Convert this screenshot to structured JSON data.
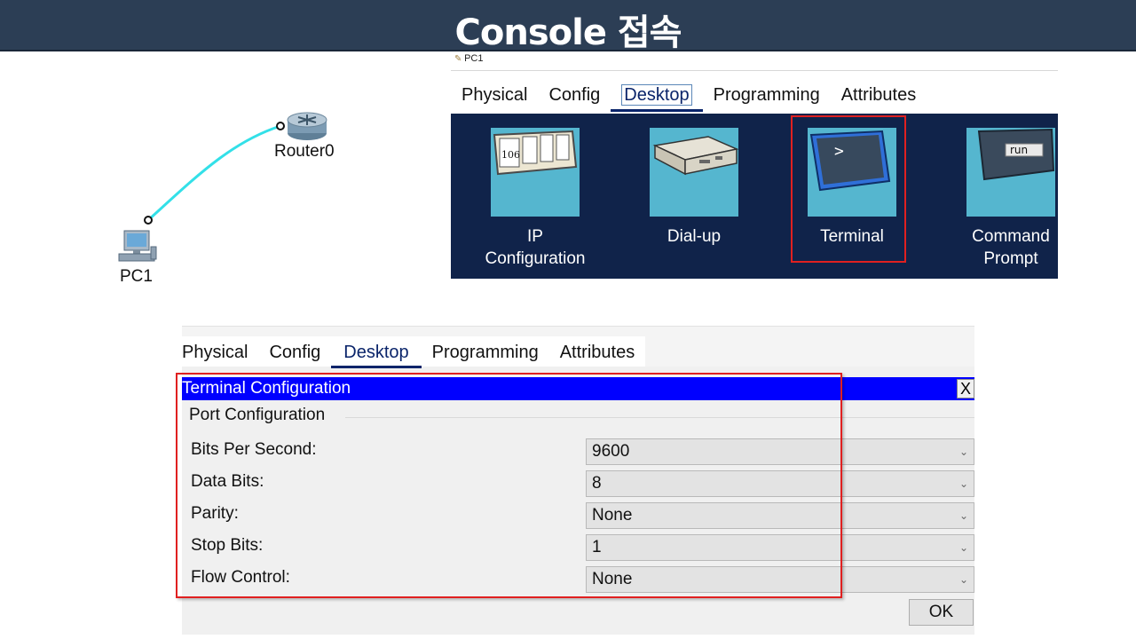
{
  "slide": {
    "title": "Console 접속",
    "colors": {
      "title_bg": "#2c3e55",
      "highlight": "#e02020",
      "desktop_bg": "#10234a",
      "tile": "#55b6cf",
      "term_header": "#0000ff"
    }
  },
  "topology": {
    "router_label": "Router0",
    "pc_label": "PC1",
    "link_color": "#33e0e8",
    "router_icon": "router-icon",
    "pc_icon": "pc-icon"
  },
  "device_window": {
    "title": "PC1",
    "tabs": [
      "Physical",
      "Config",
      "Desktop",
      "Programming",
      "Attributes"
    ],
    "active_tab": "Desktop",
    "apps": [
      {
        "label_line1": "IP",
        "label_line2": "Configuration",
        "icon": "ip-config-icon",
        "tile_text": "106"
      },
      {
        "label_line1": "Dial-up",
        "label_line2": "",
        "icon": "dial-up-modem-icon"
      },
      {
        "label_line1": "Terminal",
        "label_line2": "",
        "icon": "terminal-icon",
        "tile_text": ">"
      },
      {
        "label_line1": "Command",
        "label_line2": "Prompt",
        "icon": "command-prompt-icon",
        "tile_text": "run"
      }
    ]
  },
  "terminal_window": {
    "tabs": [
      "Physical",
      "Config",
      "Desktop",
      "Programming",
      "Attributes"
    ],
    "active_tab": "Desktop",
    "header": "Terminal Configuration",
    "close_label": "X",
    "section_title": "Port Configuration",
    "fields": [
      {
        "label": "Bits Per Second:",
        "value": "9600"
      },
      {
        "label": "Data Bits:",
        "value": "8"
      },
      {
        "label": "Parity:",
        "value": "None"
      },
      {
        "label": "Stop Bits:",
        "value": "1"
      },
      {
        "label": "Flow Control:",
        "value": "None"
      }
    ],
    "ok_label": "OK"
  }
}
